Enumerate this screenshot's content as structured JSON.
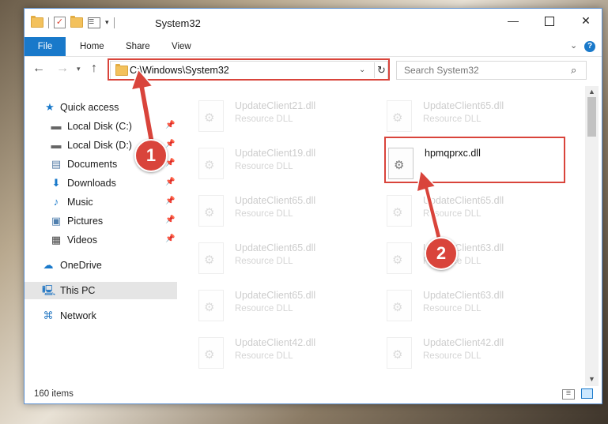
{
  "window": {
    "title": "System32",
    "controls": {
      "minimize": "—",
      "maximize": "",
      "close": "✕"
    }
  },
  "ribbon": {
    "tabs": [
      "File",
      "Home",
      "Share",
      "View"
    ],
    "help": "?"
  },
  "address": {
    "path": "C:\\Windows\\System32",
    "search_placeholder": "Search System32"
  },
  "nav": {
    "items": [
      {
        "label": "Quick access",
        "icon": "star-icon"
      },
      {
        "label": "Local Disk (C:)",
        "icon": "drive-icon",
        "pinned": true
      },
      {
        "label": "Local Disk (D:)",
        "icon": "drive-icon",
        "pinned": true
      },
      {
        "label": "Documents",
        "icon": "documents-icon",
        "pinned": true
      },
      {
        "label": "Downloads",
        "icon": "download-icon",
        "pinned": true
      },
      {
        "label": "Music",
        "icon": "music-icon",
        "pinned": true
      },
      {
        "label": "Pictures",
        "icon": "pictures-icon",
        "pinned": true
      },
      {
        "label": "Videos",
        "icon": "videos-icon",
        "pinned": true
      },
      {
        "label": "OneDrive",
        "icon": "cloud-icon"
      },
      {
        "label": "This PC",
        "icon": "computer-icon",
        "selected": true
      },
      {
        "label": "Network",
        "icon": "network-icon"
      }
    ]
  },
  "files": [
    {
      "name": "UpdateClient21.dll",
      "type": "Resource DLL"
    },
    {
      "name": "UpdateClient65.dll",
      "type": "Resource DLL"
    },
    {
      "name": "UpdateClient19.dll",
      "type": "Resource DLL"
    },
    {
      "name": "hpmqprxc.dll",
      "type": ""
    },
    {
      "name": "UpdateClient65.dll",
      "type": "Resource DLL"
    },
    {
      "name": "UpdateClient65.dll",
      "type": "Resource DLL"
    },
    {
      "name": "UpdateClient65.dll",
      "type": "Resource DLL"
    },
    {
      "name": "UpdateClient63.dll",
      "type": "Resource DLL"
    },
    {
      "name": "UpdateClient65.dll",
      "type": "Resource DLL"
    },
    {
      "name": "UpdateClient63.dll",
      "type": "Resource DLL"
    },
    {
      "name": "UpdateClient42.dll",
      "type": "Resource DLL"
    },
    {
      "name": "UpdateClient42.dll",
      "type": "Resource DLL"
    }
  ],
  "status": {
    "item_count": "160 items"
  },
  "annotations": {
    "step1": "1",
    "step2": "2",
    "color": "#d9443b"
  },
  "colors": {
    "accent": "#1979ca",
    "highlight": "#d9443b",
    "selection": "#cce8ff"
  }
}
